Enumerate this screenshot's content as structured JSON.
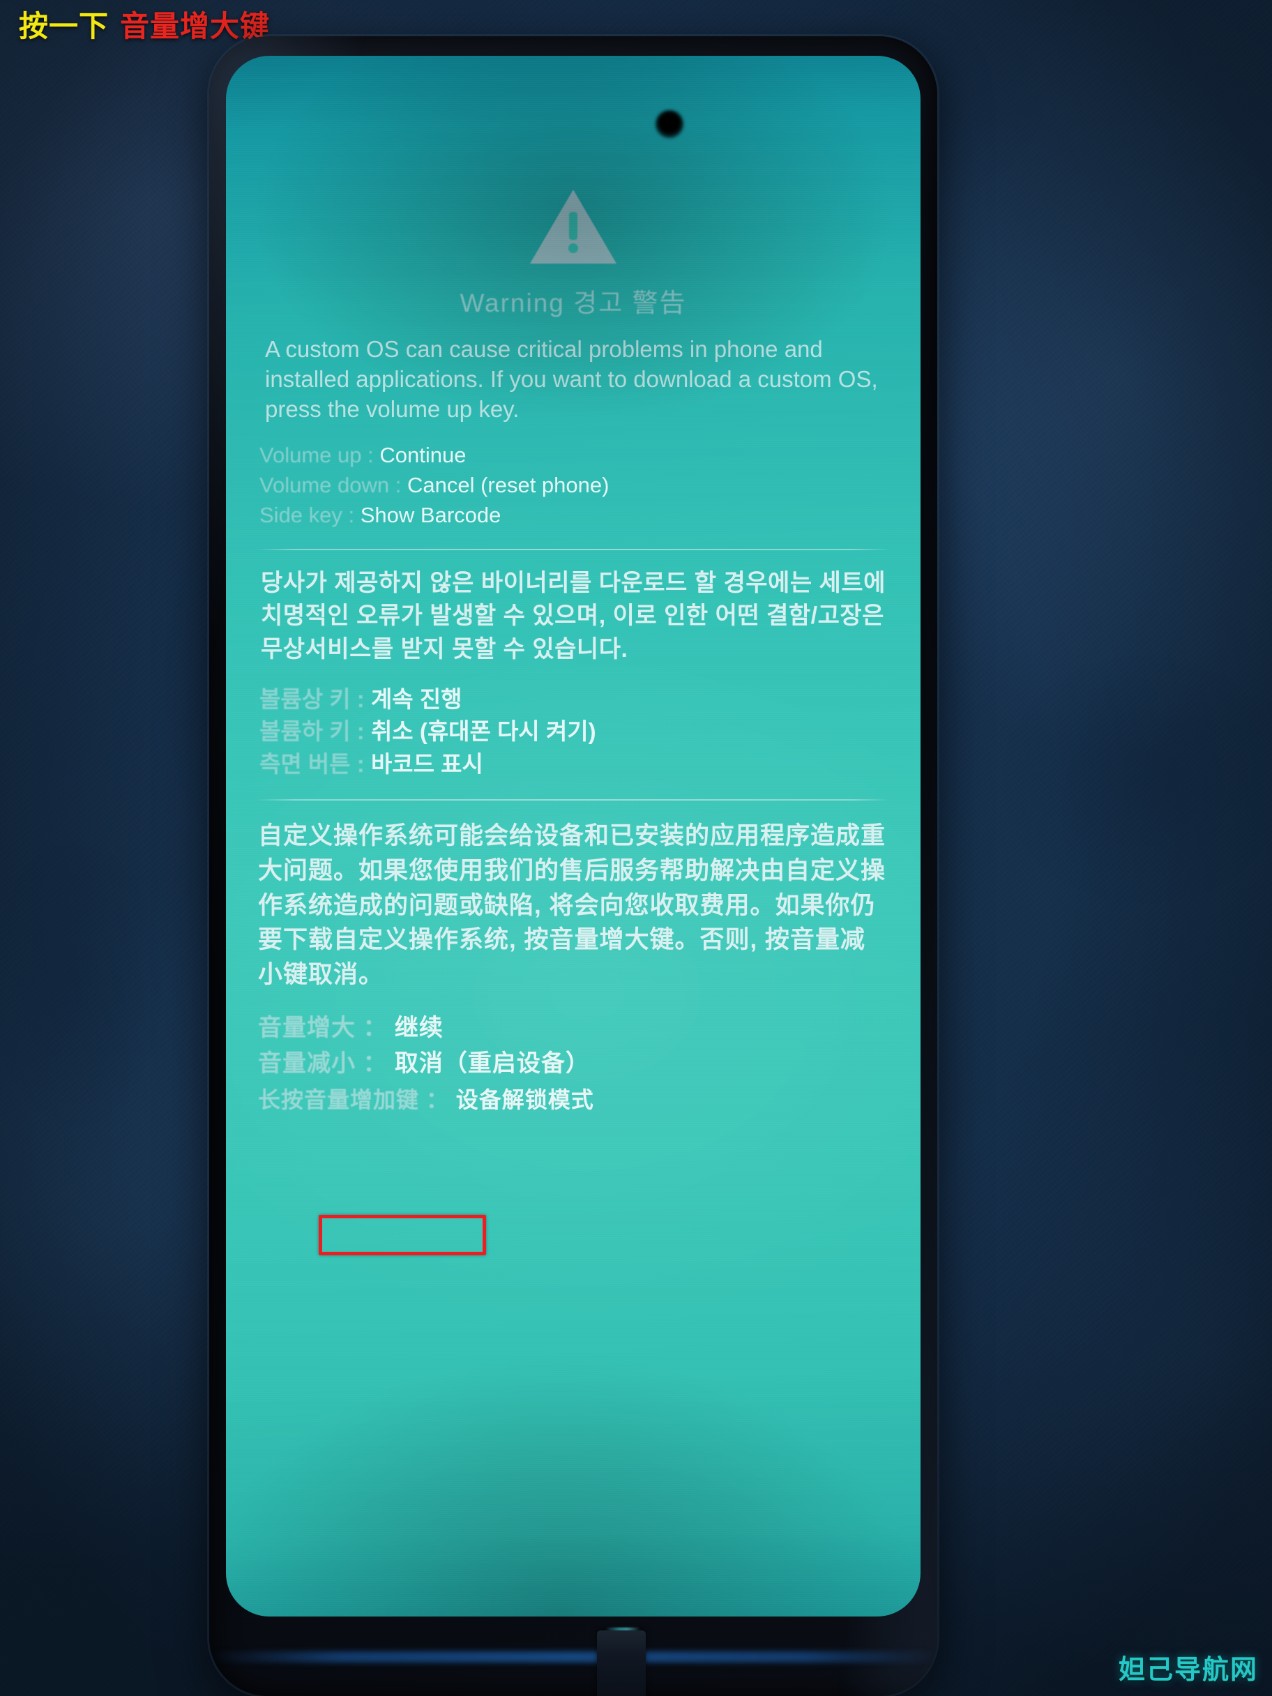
{
  "annotation": {
    "prefix": "按一下",
    "highlight": "音量增大键",
    "prefix_color": "#f3e812",
    "highlight_color": "#e8251f"
  },
  "watermark": {
    "text": "妲己导航网",
    "color": "#25c8c6"
  },
  "screen": {
    "background_color": "#3cc8b9",
    "warning_icon": "warning-triangle-icon",
    "title": "Warning 경고 警告",
    "english": {
      "body": "A custom OS can cause critical problems in phone and installed applications. If you want to download a custom OS, press the volume up key.",
      "bindings": [
        {
          "key": "Volume up : ",
          "value": "Continue"
        },
        {
          "key": "Volume down : ",
          "value": "Cancel (reset phone)"
        },
        {
          "key": "Side key : ",
          "value": "Show Barcode"
        }
      ]
    },
    "korean": {
      "body": "당사가 제공하지 않은 바이너리를 다운로드 할 경우에는 세트에 치명적인 오류가 발생할 수 있으며, 이로 인한 어떤 결함/고장은 무상서비스를 받지 못할 수 있습니다.",
      "bindings": [
        {
          "key": "볼륨상 키 : ",
          "value": "계속 진행"
        },
        {
          "key": "볼륨하 키 : ",
          "value": "취소 (휴대폰 다시 켜기)"
        },
        {
          "key": "측면 버튼 : ",
          "value": "바코드 표시"
        }
      ]
    },
    "chinese": {
      "body": "自定义操作系统可能会给设备和已安装的应用程序造成重大问题。如果您使用我们的售后服务帮助解决由自定义操作系统造成的问题或缺陷, 将会向您收取费用。如果你仍要下载自定义操作系统, 按音量增大键。否则, 按音量减小键取消。",
      "bindings": [
        {
          "key": "音量增大 ： ",
          "value": "继续"
        },
        {
          "key": "音量减小 ： ",
          "value": "取消（重启设备）"
        },
        {
          "key": "长按音量增加键 ： ",
          "value": "设备解锁模式"
        }
      ]
    },
    "highlight_box": {
      "target": "音量增大 ： 继续",
      "color": "#ef1d20"
    }
  }
}
